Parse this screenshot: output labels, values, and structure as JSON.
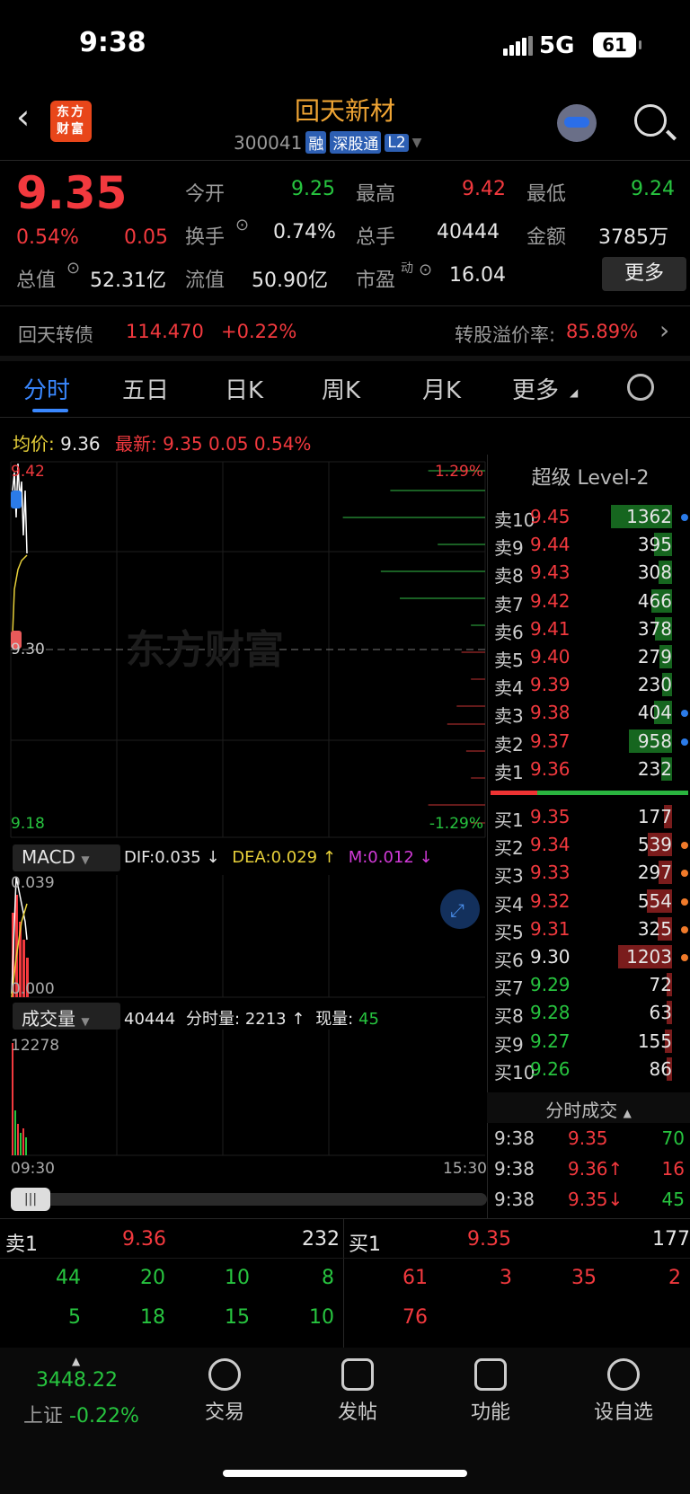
{
  "status": {
    "time": "9:38",
    "network": "5G",
    "battery": "61"
  },
  "header": {
    "stock_name": "回天新材",
    "code": "300041",
    "tags": [
      "融",
      "深股通",
      "L2"
    ],
    "logo_text": "东方财富"
  },
  "quote": {
    "price": "9.35",
    "change_pct": "0.54%",
    "change": "0.05",
    "open_label": "今开",
    "open": "9.25",
    "high_label": "最高",
    "high": "9.42",
    "low_label": "最低",
    "low": "9.24",
    "turnover_label": "换手",
    "turnover": "0.74%",
    "volume_label": "总手",
    "volume": "40444",
    "amount_label": "金额",
    "amount": "3785万",
    "mktcap_label": "总值",
    "mktcap": "52.31亿",
    "float_label": "流值",
    "float": "50.90亿",
    "pe_label": "市盈",
    "pe_sup": "动",
    "pe": "16.04",
    "more_label": "更多"
  },
  "bond": {
    "name": "回天转债",
    "price": "114.470",
    "change": "+0.22%",
    "premium_label": "转股溢价率:",
    "premium": "85.89%"
  },
  "tabs": [
    "分时",
    "五日",
    "日K",
    "周K",
    "月K",
    "更多"
  ],
  "avg": {
    "avg_label": "均价:",
    "avg": "9.36",
    "last_label": "最新:",
    "last": "9.35",
    "chg": "0.05",
    "pct": "0.54%"
  },
  "chart": {
    "ytop": "9.42",
    "ymid": "9.30",
    "ybot": "9.18",
    "pct_top": "1.29%",
    "pct_bot": "-1.29%",
    "watermark": "东方财富",
    "time_start": "09:30",
    "time_end": "15:30",
    "macd": {
      "label": "MACD",
      "dif": "DIF:0.035",
      "dif_arrow": "↓",
      "dea": "DEA:0.029",
      "dea_arrow": "↑",
      "m": "M:0.012",
      "m_arrow": "↓",
      "ymax": "0.039",
      "ymin": "0.000"
    },
    "vol": {
      "label": "成交量",
      "total": "40444",
      "fen_label": "分时量:",
      "fen": "2213",
      "fen_arrow": "↑",
      "now_label": "现量:",
      "now": "45",
      "ymax": "12278"
    }
  },
  "orderbook": {
    "title": "超级 Level-2",
    "asks": [
      {
        "l": "卖10",
        "p": "9.45",
        "v": "1362",
        "dot": "#2b7be8"
      },
      {
        "l": "卖9",
        "p": "9.44",
        "v": "395"
      },
      {
        "l": "卖8",
        "p": "9.43",
        "v": "308"
      },
      {
        "l": "卖7",
        "p": "9.42",
        "v": "466"
      },
      {
        "l": "卖6",
        "p": "9.41",
        "v": "378"
      },
      {
        "l": "卖5",
        "p": "9.40",
        "v": "279"
      },
      {
        "l": "卖4",
        "p": "9.39",
        "v": "230"
      },
      {
        "l": "卖3",
        "p": "9.38",
        "v": "404",
        "dot": "#2b7be8"
      },
      {
        "l": "卖2",
        "p": "9.37",
        "v": "958",
        "dot": "#2b7be8"
      },
      {
        "l": "卖1",
        "p": "9.36",
        "v": "232"
      }
    ],
    "bids": [
      {
        "l": "买1",
        "p": "9.35",
        "v": "177"
      },
      {
        "l": "买2",
        "p": "9.34",
        "v": "539",
        "dot": "#f07a2a"
      },
      {
        "l": "买3",
        "p": "9.33",
        "v": "297",
        "dot": "#f07a2a"
      },
      {
        "l": "买4",
        "p": "9.32",
        "v": "554",
        "dot": "#f07a2a"
      },
      {
        "l": "买5",
        "p": "9.31",
        "v": "325",
        "dot": "#f07a2a"
      },
      {
        "l": "买6",
        "p": "9.30",
        "v": "1203",
        "dot": "#f07a2a"
      },
      {
        "l": "买7",
        "p": "9.29",
        "v": "72"
      },
      {
        "l": "买8",
        "p": "9.28",
        "v": "63"
      },
      {
        "l": "买9",
        "p": "9.27",
        "v": "155"
      },
      {
        "l": "买10",
        "p": "9.26",
        "v": "86"
      }
    ],
    "ticks_title": "分时成交",
    "ticks": [
      {
        "t": "9:38",
        "p": "9.35",
        "v": "70"
      },
      {
        "t": "9:38",
        "p": "9.36↑",
        "v": "16"
      },
      {
        "t": "9:38",
        "p": "9.35↓",
        "v": "45"
      }
    ]
  },
  "bottom": {
    "ask_label": "卖1",
    "ask_price": "9.36",
    "ask_vol": "232",
    "bid_label": "买1",
    "bid_price": "9.35",
    "bid_vol": "177",
    "ask_queue": [
      "44",
      "20",
      "10",
      "8",
      "5",
      "18",
      "15",
      "10"
    ],
    "bid_queue": [
      "61",
      "3",
      "35",
      "2",
      "76"
    ]
  },
  "nav": {
    "index_value": "3448.22",
    "index_name": "上证",
    "index_pct": "-0.22%",
    "items": [
      "交易",
      "发帖",
      "功能",
      "设自选"
    ]
  }
}
